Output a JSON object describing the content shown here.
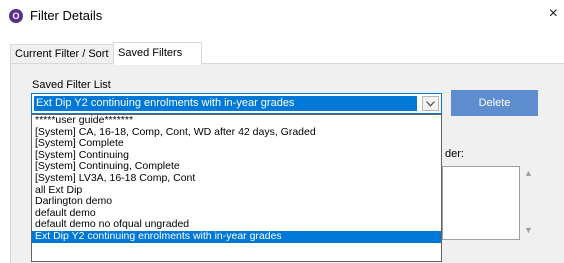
{
  "window": {
    "title": "Filter Details",
    "icon_letter": "O",
    "close_glyph": "×"
  },
  "tabs": [
    {
      "label": "Current Filter / Sort"
    },
    {
      "label": "Saved Filters"
    }
  ],
  "saved_filters": {
    "label": "Saved Filter List",
    "selected": "Ext Dip Y2 continuing enrolments with in-year grades",
    "delete_label": "Delete",
    "items": [
      "*****user guide*******",
      "[System]  CA, 16-18, Comp, Cont, WD after 42 days, Graded",
      "[System]  Complete",
      "[System]  Continuing",
      "[System]  Continuing, Complete",
      "[System]  LV3A, 16-18 Comp, Cont",
      "all Ext Dip",
      "Darlington demo",
      "default demo",
      "default demo no ofqual ungraded",
      "Ext Dip Y2 continuing enrolments with in-year grades"
    ],
    "selected_index": 10
  },
  "order": {
    "label_fragment": "der:",
    "up_glyph": "▲",
    "down_glyph": "▼"
  },
  "colors": {
    "accent": "#0078d7",
    "button": "#5d8ccf",
    "app_icon": "#5b2d8e"
  }
}
